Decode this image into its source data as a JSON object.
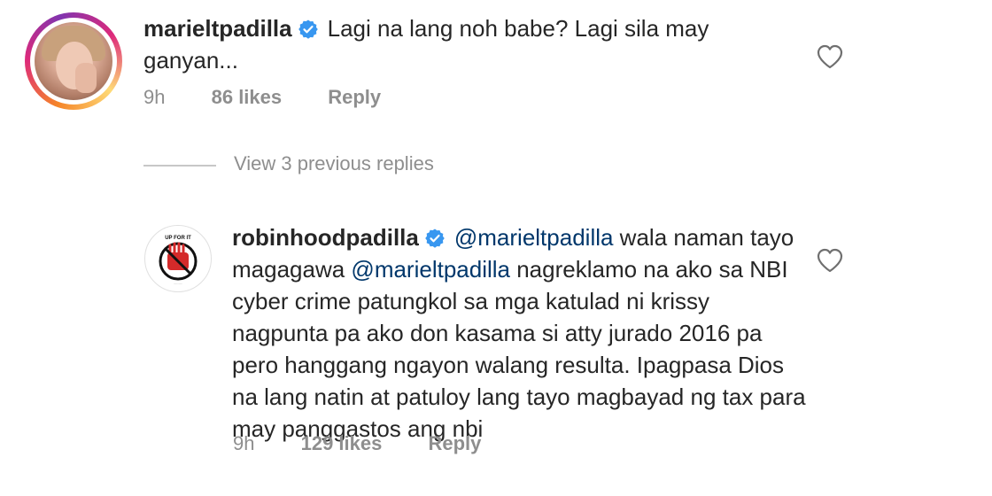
{
  "comments": [
    {
      "username": "marieltpadilla",
      "text": "Lagi na lang noh babe? Lagi sila may ganyan...",
      "time": "9h",
      "likes": "86 likes",
      "reply_label": "Reply"
    },
    {
      "username": "robinhoodpadilla",
      "mention_1": "@marieltpadilla",
      "text_part_1": " wala naman tayo magagawa ",
      "mention_2": "@marieltpadilla",
      "text_part_2": " nagreklamo na ako sa NBI cyber crime patungkol sa mga katulad ni krissy nagpunta pa ako don kasama si atty jurado 2016 pa pero hanggang ngayon walang resulta. Ipagpasa Dios na lang natin at patuloy lang tayo magbayad ng tax para may panggastos ang nbi",
      "time": "9h",
      "likes": "129 likes",
      "reply_label": "Reply"
    }
  ],
  "view_replies_label": "View 3 previous replies",
  "avatar2_text": "UP FOR IT",
  "colors": {
    "text": "#262626",
    "meta": "#8e8e8e",
    "verified": "#3897f0",
    "mention": "#00376b"
  },
  "icons": {
    "verified": "verified-badge-icon",
    "heart": "heart-outline-icon"
  }
}
